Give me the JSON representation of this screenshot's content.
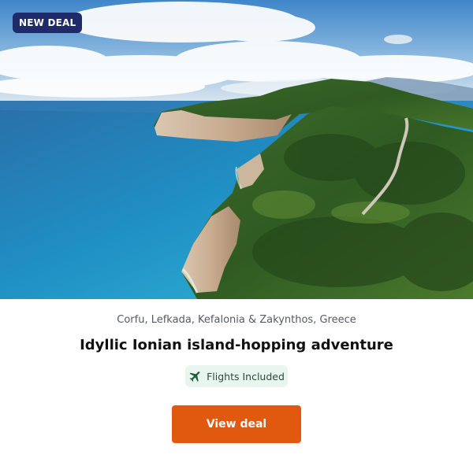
{
  "card": {
    "badge": "NEW DEAL",
    "image": {
      "subject": "aerial-coastline-photo"
    },
    "locations": "Corfu, Lefkada, Kefalonia & Zakynthos, Greece",
    "title": "Idyllic Ionian island-hopping adventure",
    "feature": {
      "icon": "airplane-icon",
      "label": "Flights Included"
    },
    "cta_label": "View deal"
  },
  "colors": {
    "badge_bg": "#1f2a6b",
    "cta_bg": "#e0590f",
    "feature_bg": "#e9f6ef",
    "feature_icon": "#1f5a3a"
  }
}
